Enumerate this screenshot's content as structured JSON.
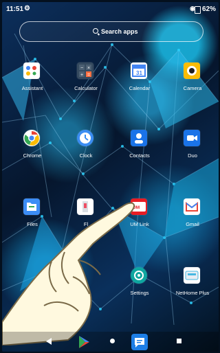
{
  "status_bar": {
    "time": "11:51",
    "battery": "62%"
  },
  "search": {
    "label": "Search apps"
  },
  "apps": [
    {
      "label": "Assistant",
      "icon": "assistant-icon"
    },
    {
      "label": "Calculator",
      "icon": "calculator-icon"
    },
    {
      "label": "Calendar",
      "icon": "calendar-icon"
    },
    {
      "label": "Camera",
      "icon": "camera-icon"
    },
    {
      "label": "Chrome",
      "icon": "chrome-icon"
    },
    {
      "label": "Clock",
      "icon": "clock-icon"
    },
    {
      "label": "Contacts",
      "icon": "contacts-icon"
    },
    {
      "label": "Duo",
      "icon": "duo-icon"
    },
    {
      "label": "Files",
      "icon": "files-icon"
    },
    {
      "label": "Fl",
      "icon": "flashlight-icon"
    },
    {
      "label": "UM Link",
      "icon": "um-link-icon"
    },
    {
      "label": "Gmail",
      "icon": "gmail-icon"
    },
    {
      "label": "Settings",
      "icon": "settings-icon"
    },
    {
      "label": "NetHome Plus",
      "icon": "nethome-plus-icon"
    }
  ],
  "navigation": {
    "back": "back-icon",
    "play_store": "play-store-icon",
    "home": "home-icon",
    "messages": "messages-icon",
    "recent": "recent-apps-icon"
  }
}
